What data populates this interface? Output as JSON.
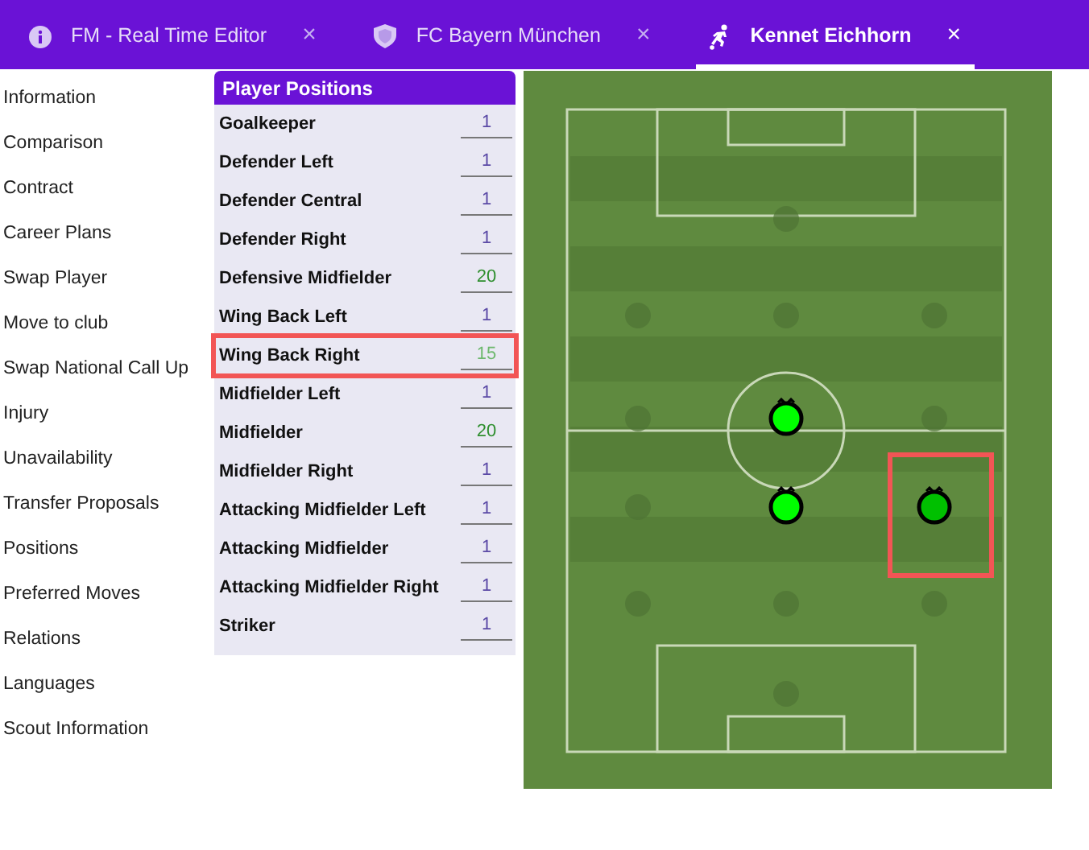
{
  "tabs": [
    {
      "kind": "info",
      "label": "FM - Real Time Editor",
      "close": "×",
      "selected": false
    },
    {
      "kind": "shield",
      "label": "FC Bayern München",
      "close": "×",
      "selected": false
    },
    {
      "kind": "player",
      "label": "Kennet Eichhorn",
      "close": "×",
      "selected": true
    }
  ],
  "menu": [
    "Information",
    "Comparison",
    "Contract",
    "Career Plans",
    "Swap Player",
    "Move to club",
    "Swap National Call Up",
    "Injury",
    "Unavailability",
    "Transfer Proposals",
    "Positions",
    "Preferred Moves",
    "Relations",
    "Languages",
    "Scout Information"
  ],
  "positions_panel": {
    "title": "Player Positions",
    "rows": [
      {
        "label": "Goalkeeper",
        "value": "1",
        "kind": "none",
        "highlighted": false
      },
      {
        "label": "Defender Left",
        "value": "1",
        "kind": "none",
        "highlighted": false
      },
      {
        "label": "Defender Central",
        "value": "1",
        "kind": "none",
        "highlighted": false
      },
      {
        "label": "Defender Right",
        "value": "1",
        "kind": "none",
        "highlighted": false
      },
      {
        "label": "Defensive Midfielder",
        "value": "20",
        "kind": "natural",
        "highlighted": false
      },
      {
        "label": "Wing Back Left",
        "value": "1",
        "kind": "none",
        "highlighted": false
      },
      {
        "label": "Wing Back Right",
        "value": "15",
        "kind": "accomplished",
        "highlighted": true
      },
      {
        "label": "Midfielder Left",
        "value": "1",
        "kind": "none",
        "highlighted": false
      },
      {
        "label": "Midfielder",
        "value": "20",
        "kind": "natural",
        "highlighted": false
      },
      {
        "label": "Midfielder Right",
        "value": "1",
        "kind": "none",
        "highlighted": false
      },
      {
        "label": "Attacking Midfielder Left",
        "value": "1",
        "kind": "none",
        "highlighted": false
      },
      {
        "label": "Attacking Midfielder",
        "value": "1",
        "kind": "none",
        "highlighted": false
      },
      {
        "label": "Attacking Midfielder Right",
        "value": "1",
        "kind": "none",
        "highlighted": false
      },
      {
        "label": "Striker",
        "value": "1",
        "kind": "none",
        "highlighted": false
      }
    ]
  }
}
